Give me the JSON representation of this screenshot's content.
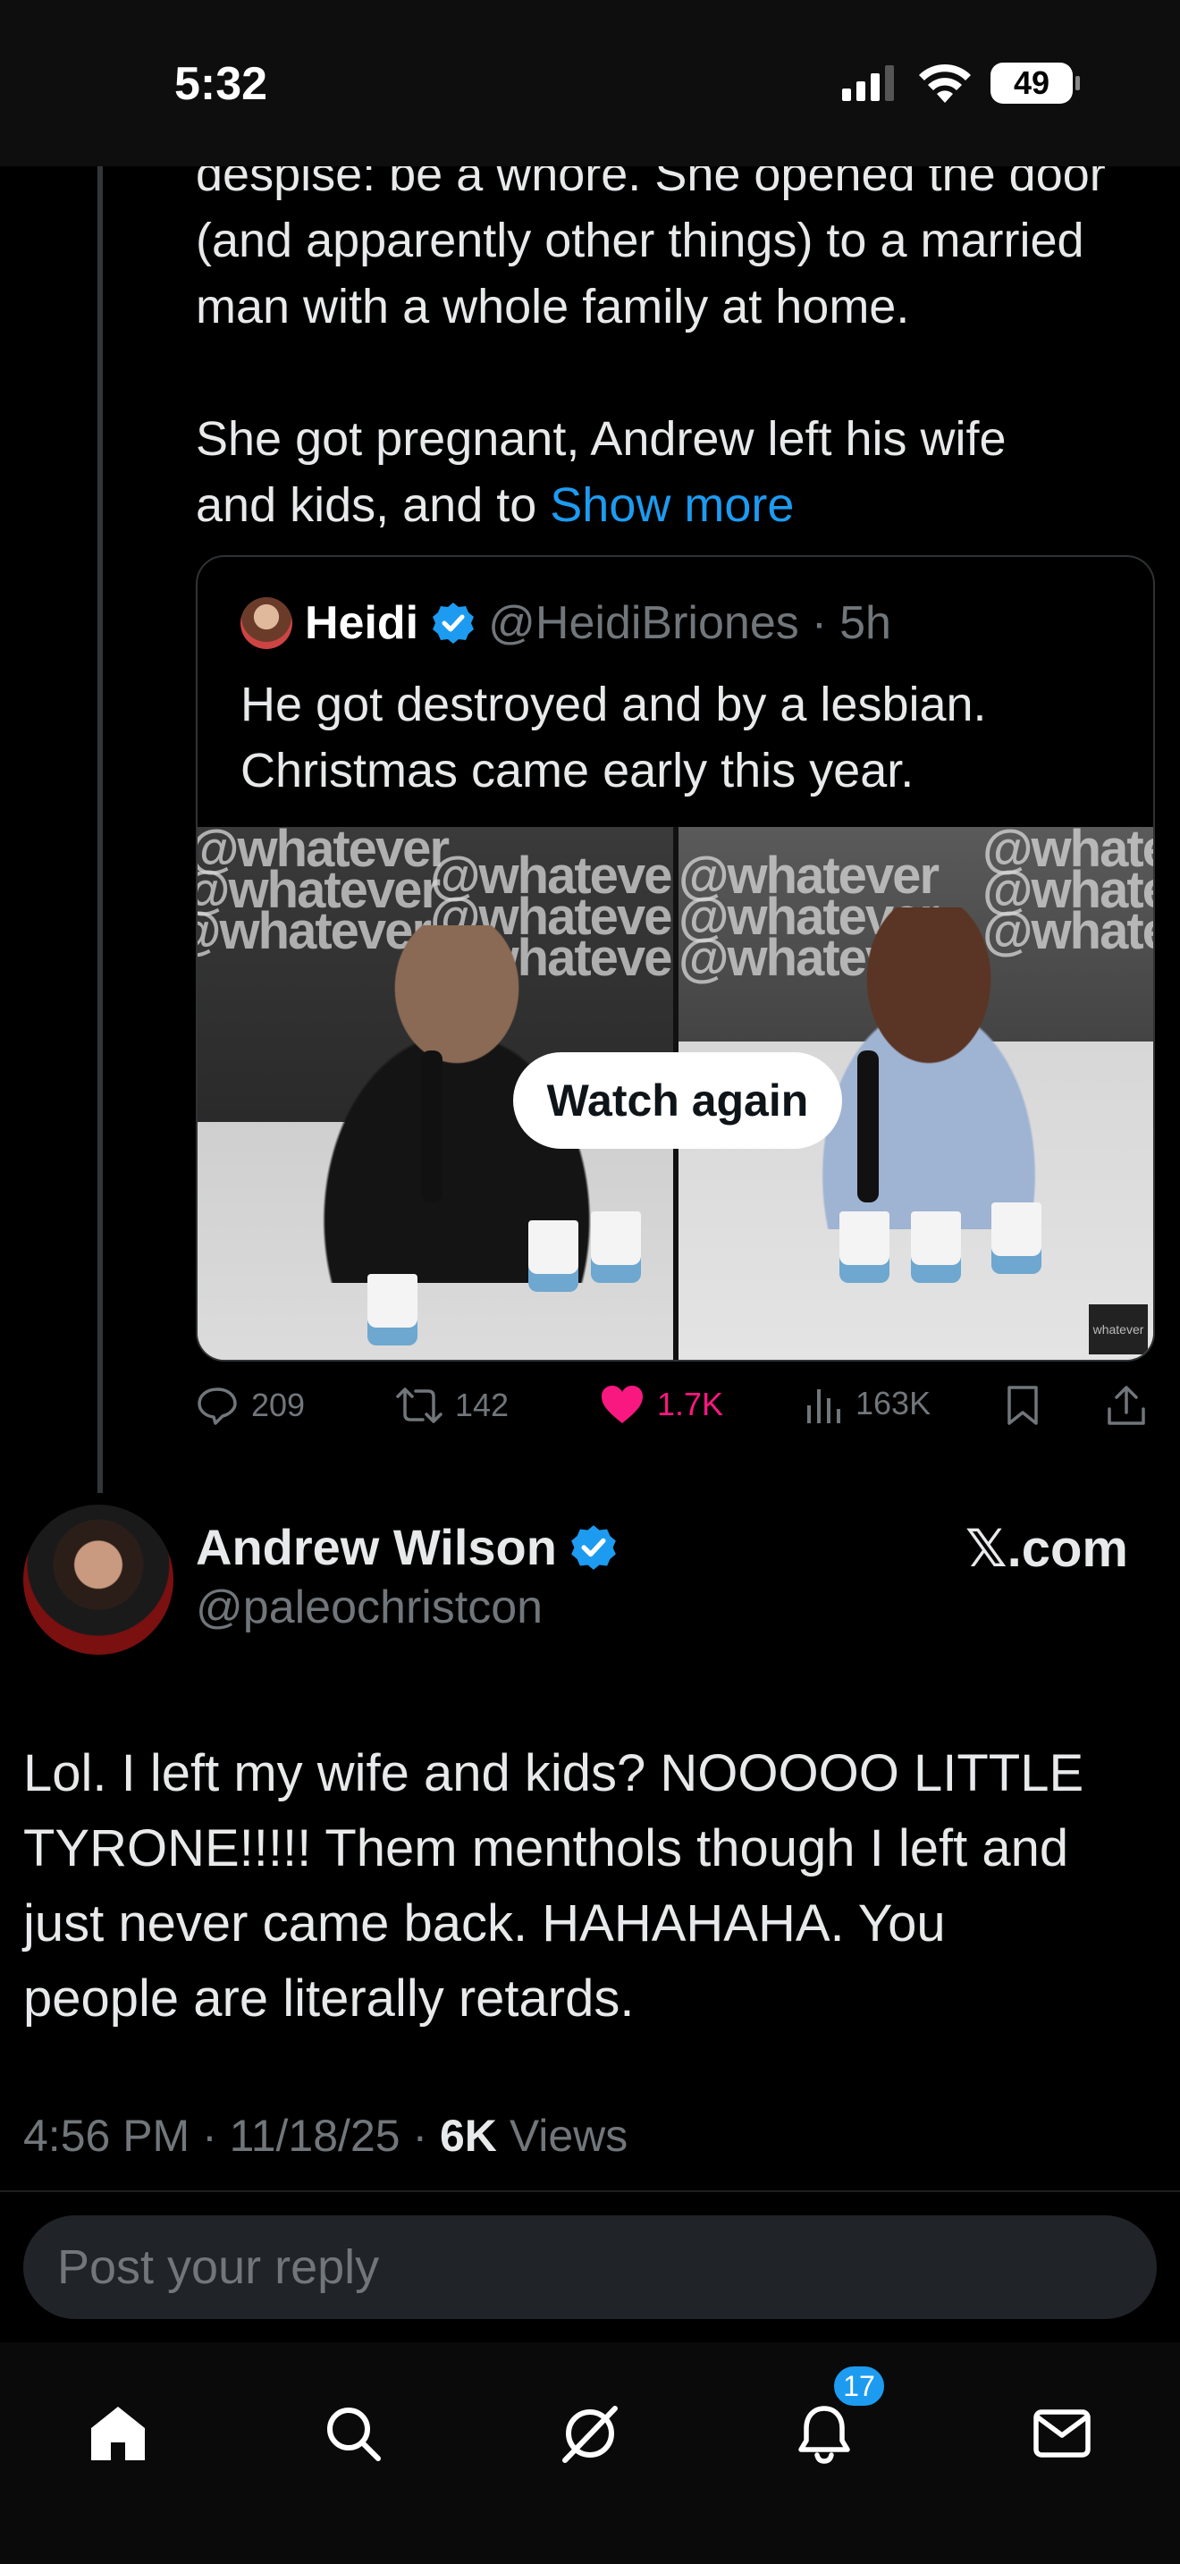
{
  "status_bar": {
    "time": "5:32",
    "battery": "49"
  },
  "parent_post": {
    "text_line1": "despise: be a whore. She opened the door",
    "text_line2": "(and apparently other things) to a married",
    "text_line3": "man with a whole family at home.",
    "text_line4": "She got pregnant, Andrew left his wife",
    "text_line5_prefix": "and kids, and to ",
    "show_more": "Show more",
    "quote": {
      "name": "Heidi",
      "handle": "@HeidiBriones",
      "dot": "·",
      "age": "5h",
      "text_line1": "He got destroyed and by a lesbian.",
      "text_line2": "Christmas came early this year.",
      "video_button": "Watch again",
      "watermark": "@whatever",
      "badge": "whatever"
    },
    "actions": {
      "replies": "209",
      "reposts": "142",
      "likes": "1.7K",
      "views": "163K"
    }
  },
  "main_post": {
    "name": "Andrew Wilson",
    "handle": "@paleochristcon",
    "source": "𝕏.com",
    "text_line1": "Lol. I left my wife and kids? NOOOOO LITTLE",
    "text_line2": "TYRONE!!!!! Them menthols though I left and",
    "text_line3": "just never came back. HAHAHAHA. You",
    "text_line4": "people are literally retards.",
    "time": "4:56 PM · 11/18/25 · ",
    "views_count": "6K",
    "views_label": " Views"
  },
  "reply": {
    "placeholder": "Post your reply"
  },
  "tab_bar": {
    "notifications_badge": "17"
  },
  "colors": {
    "accent": "#1d9bf0",
    "like": "#f91880",
    "muted": "#71767b",
    "background": "#000000"
  }
}
